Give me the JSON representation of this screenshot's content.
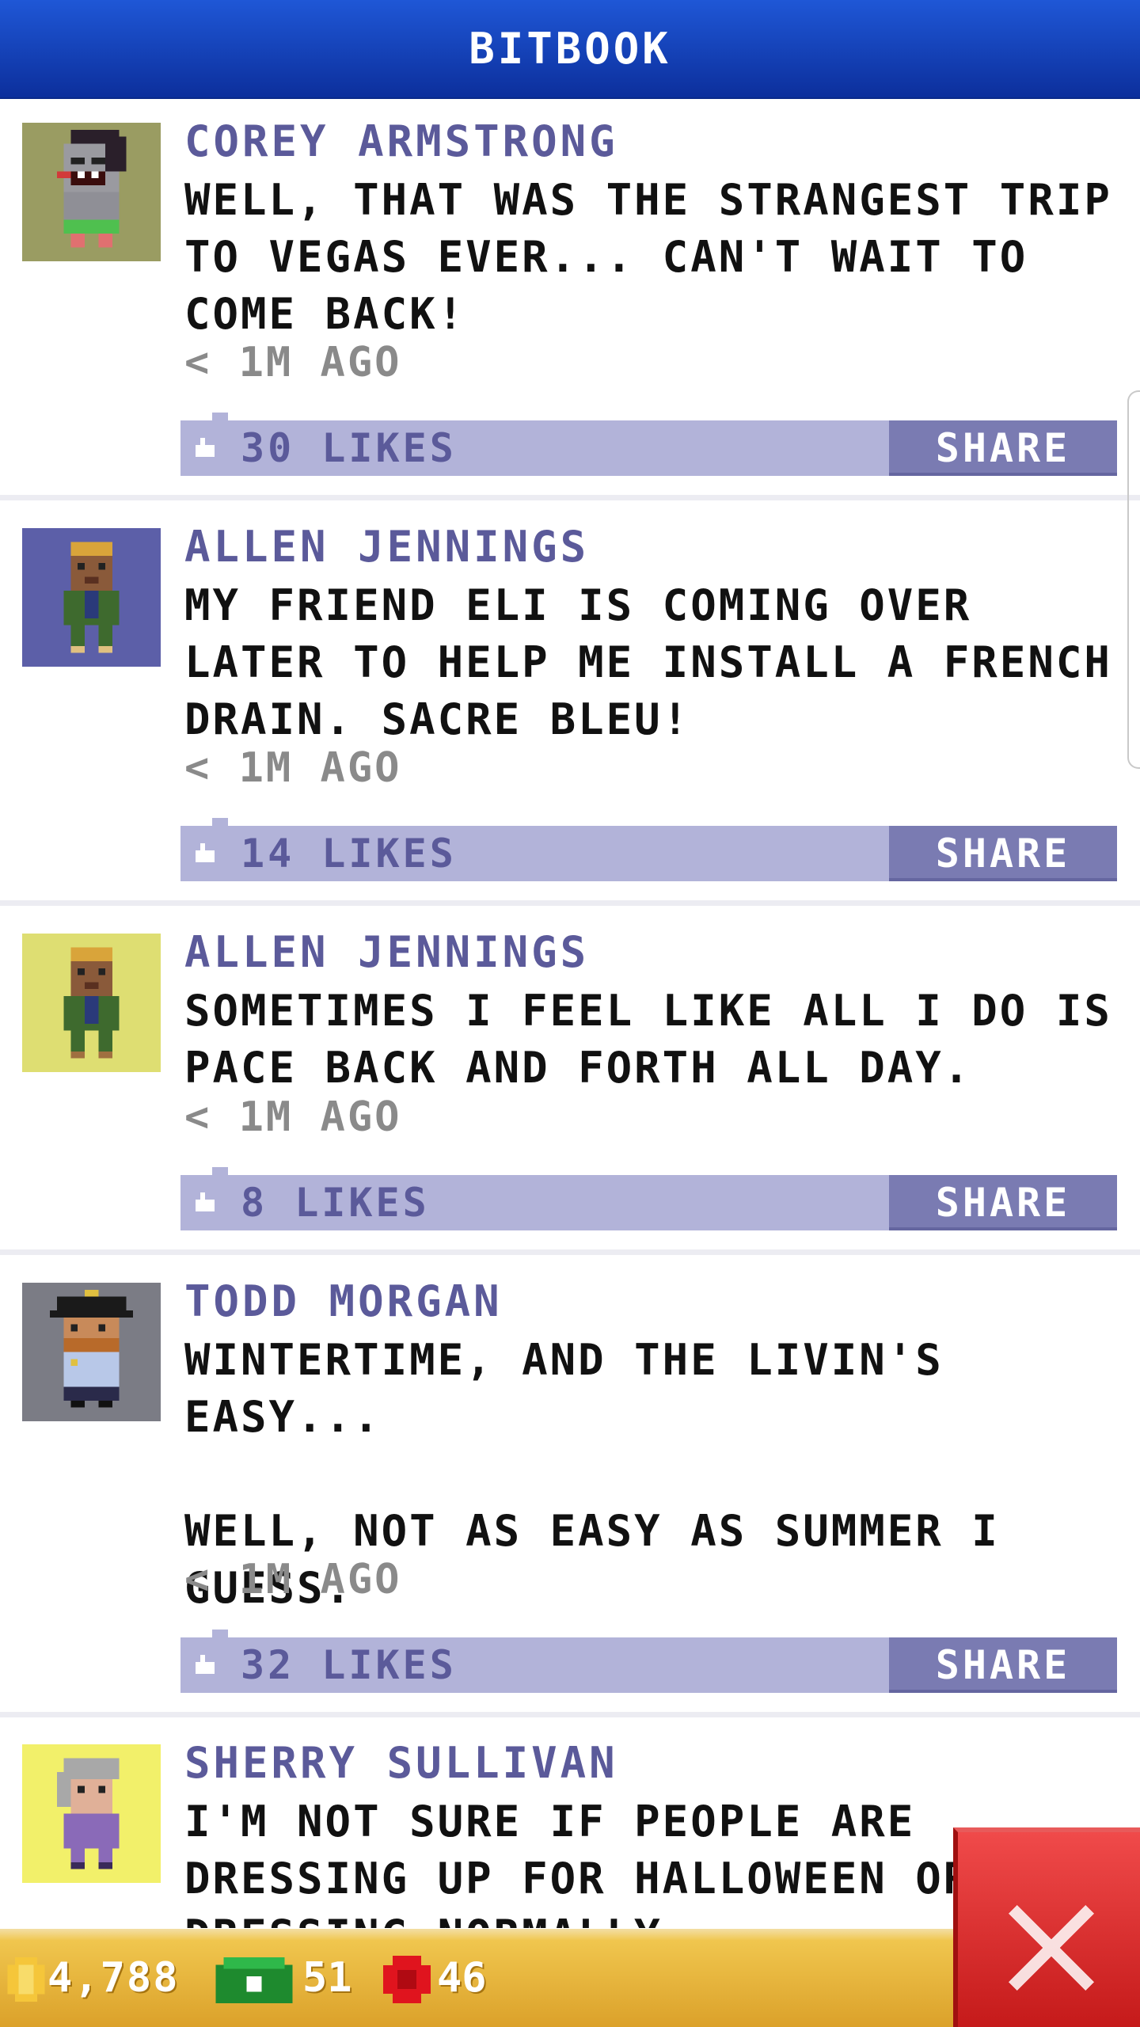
{
  "header": {
    "title": "BITBOOK"
  },
  "posts": [
    {
      "author": "COREY ARMSTRONG",
      "text": "WELL, THAT WAS THE STRANGEST TRIP TO VEGAS EVER... CAN'T WAIT TO COME BACK!",
      "time": "< 1M AGO",
      "likes": "30 LIKES",
      "share": "SHARE",
      "avatar_bg": "#9a9c62",
      "avatar_icon": "zombie-avatar-icon"
    },
    {
      "author": "ALLEN JENNINGS",
      "text": "MY FRIEND ELI IS COMING OVER LATER TO HELP ME INSTALL A FRENCH DRAIN. SACRE BLEU!",
      "time": "< 1M AGO",
      "likes": "14 LIKES",
      "share": "SHARE",
      "avatar_bg": "#5c5fa8",
      "avatar_icon": "man-avatar-icon"
    },
    {
      "author": "ALLEN JENNINGS",
      "text": "SOMETIMES I FEEL LIKE ALL I DO IS PACE BACK AND FORTH ALL DAY.",
      "time": "< 1M AGO",
      "likes": "8 LIKES",
      "share": "SHARE",
      "avatar_bg": "#dede72",
      "avatar_icon": "man-avatar-icon"
    },
    {
      "author": "TODD MORGAN",
      "text": "WINTERTIME, AND THE LIVIN'S EASY...\n\nWELL, NOT AS EASY AS SUMMER I GUESS.",
      "time": "< 1M AGO",
      "likes": "32 LIKES",
      "share": "SHARE",
      "avatar_bg": "#7b7c85",
      "avatar_icon": "police-officer-avatar-icon"
    },
    {
      "author": "SHERRY SULLIVAN",
      "text": "I'M NOT SURE IF PEOPLE ARE DRESSING UP FOR HALLOWEEN OR JUST DRESSING NORMALLY.",
      "time": "",
      "likes": "",
      "share": "",
      "avatar_bg": "#f2f06a",
      "avatar_icon": "elderly-woman-avatar-icon"
    }
  ],
  "status_bar": {
    "coins": "4,788",
    "bux": "51",
    "stock": "46"
  },
  "colors": {
    "header": "#1a4cc8",
    "like_bar": "#b2b3d9",
    "share_button": "#7a7bb2",
    "name": "#5b5a9a",
    "close_button": "#e02a2a"
  }
}
